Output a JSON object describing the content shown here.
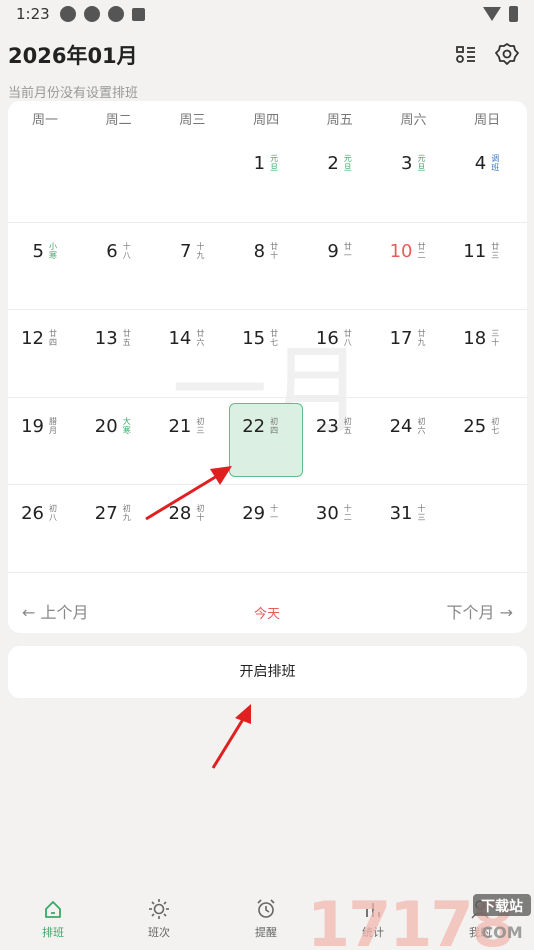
{
  "status": {
    "time": "1:23"
  },
  "header": {
    "title": "2026年01月",
    "subtitle": "当前月份没有设置排班"
  },
  "calendar": {
    "weekdays": [
      "周一",
      "周二",
      "周三",
      "周四",
      "周五",
      "周六",
      "周日"
    ],
    "watermark": "一月",
    "rows": [
      [
        null,
        null,
        null,
        {
          "day": "1",
          "lunar": "元旦",
          "style": "green"
        },
        {
          "day": "2",
          "lunar": "元旦",
          "style": "green"
        },
        {
          "day": "3",
          "lunar": "元旦",
          "style": "green"
        },
        {
          "day": "4",
          "lunar": "调班",
          "style": "blue"
        }
      ],
      [
        {
          "day": "5",
          "lunar": "小寒",
          "style": "green"
        },
        {
          "day": "6",
          "lunar": "十八",
          "style": ""
        },
        {
          "day": "7",
          "lunar": "十九",
          "style": ""
        },
        {
          "day": "8",
          "lunar": "廿十",
          "style": ""
        },
        {
          "day": "9",
          "lunar": "廿一",
          "style": ""
        },
        {
          "day": "10",
          "lunar": "廿二",
          "style": "",
          "day_style": "red"
        },
        {
          "day": "11",
          "lunar": "廿三",
          "style": ""
        }
      ],
      [
        {
          "day": "12",
          "lunar": "廿四",
          "style": ""
        },
        {
          "day": "13",
          "lunar": "廿五",
          "style": ""
        },
        {
          "day": "14",
          "lunar": "廿六",
          "style": ""
        },
        {
          "day": "15",
          "lunar": "廿七",
          "style": ""
        },
        {
          "day": "16",
          "lunar": "廿八",
          "style": ""
        },
        {
          "day": "17",
          "lunar": "廿九",
          "style": ""
        },
        {
          "day": "18",
          "lunar": "三十",
          "style": ""
        }
      ],
      [
        {
          "day": "19",
          "lunar": "腊月",
          "style": ""
        },
        {
          "day": "20",
          "lunar": "大寒",
          "style": "green"
        },
        {
          "day": "21",
          "lunar": "初三",
          "style": ""
        },
        {
          "day": "22",
          "lunar": "初四",
          "style": "",
          "selected": true
        },
        {
          "day": "23",
          "lunar": "初五",
          "style": ""
        },
        {
          "day": "24",
          "lunar": "初六",
          "style": ""
        },
        {
          "day": "25",
          "lunar": "初七",
          "style": ""
        }
      ],
      [
        {
          "day": "26",
          "lunar": "初八",
          "style": ""
        },
        {
          "day": "27",
          "lunar": "初九",
          "style": ""
        },
        {
          "day": "28",
          "lunar": "初十",
          "style": ""
        },
        {
          "day": "29",
          "lunar": "十一",
          "style": ""
        },
        {
          "day": "30",
          "lunar": "十二",
          "style": ""
        },
        {
          "day": "31",
          "lunar": "十三",
          "style": ""
        },
        null
      ]
    ],
    "nav": {
      "prev": "← 上个月",
      "today": "今天",
      "next": "下个月 →"
    }
  },
  "start_button": "开启排班",
  "bottom_nav": [
    {
      "label": "排班",
      "icon": "home-icon",
      "active": true
    },
    {
      "label": "班次",
      "icon": "sun-icon",
      "active": false
    },
    {
      "label": "提醒",
      "icon": "alarm-clock-icon",
      "active": false
    },
    {
      "label": "统计",
      "icon": "stats-icon",
      "active": false
    },
    {
      "label": "我的",
      "icon": "user-icon",
      "active": false
    }
  ],
  "watermark_logo": {
    "digits": "17178",
    "text1": "下载站",
    "text2": "COM"
  },
  "colors": {
    "accent": "#3aa868",
    "holiday_red": "#e85c5c",
    "workday_blue": "#3a78c9",
    "selected_bg": "#dcefe3",
    "arrow": "#e02020"
  }
}
